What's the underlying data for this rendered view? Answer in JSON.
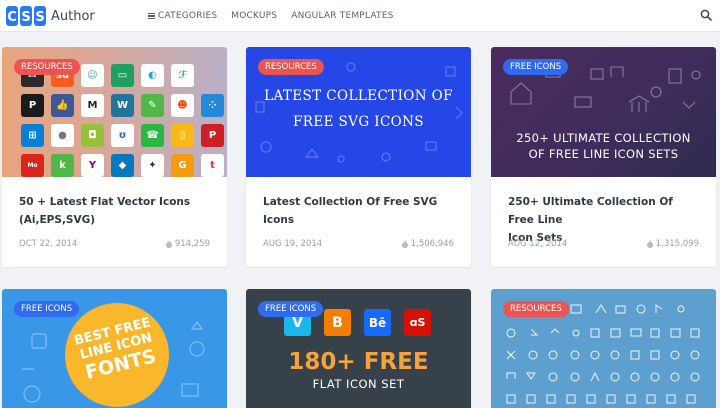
{
  "header": {
    "logo_mark": "CSS",
    "logo_text": "Author",
    "nav": [
      {
        "label": "CATEGORIES",
        "icon": "hamburger-icon"
      },
      {
        "label": "MOCKUPS"
      },
      {
        "label": "ANGULAR TEMPLATES"
      }
    ],
    "search_icon": "search-icon"
  },
  "colors": {
    "accent": "#2979ff",
    "badge_resources": "#ef5350",
    "badge_free_icons": "#2e6bf0",
    "header_bg": "#ffffff",
    "page_bg": "#f1f2f5"
  },
  "cards": [
    {
      "badge": "RESOURCES",
      "title_line1": "50 + Latest Flat Vector Icons",
      "title_line2": "(Ai,EPS,SVG)",
      "date": "OCT 22, 2014",
      "views": "914,259"
    },
    {
      "badge": "RESOURCES",
      "thumb_text_line1": "LATEST COLLECTION OF",
      "thumb_text_line2": "FREE SVG ICONS",
      "title_line1": "Latest Collection Of Free SVG Icons",
      "date": "AUG 19, 2014",
      "views": "1,506,946"
    },
    {
      "badge": "FREE ICONS",
      "thumb_text_line1": "250+ ULTIMATE COLLECTION",
      "thumb_text_line2": "OF FREE LINE ICON SETS",
      "title_line1": "250+ Ultimate Collection Of Free Line",
      "title_line2": "Icon Sets",
      "date": "AUG 12, 2014",
      "views": "1,315,099"
    },
    {
      "badge": "FREE ICONS",
      "thumb_text_line1": "BEST FREE",
      "thumb_text_line2": "LINE ICON",
      "thumb_text_line3": "FONTS"
    },
    {
      "badge": "FREE ICONS",
      "thumb_text_line1": "180+ FREE",
      "thumb_text_line2": "FLAT ICON SET",
      "logos": [
        "V",
        "B",
        "Bē",
        "ɑS"
      ]
    },
    {
      "badge": "RESOURCES"
    }
  ]
}
